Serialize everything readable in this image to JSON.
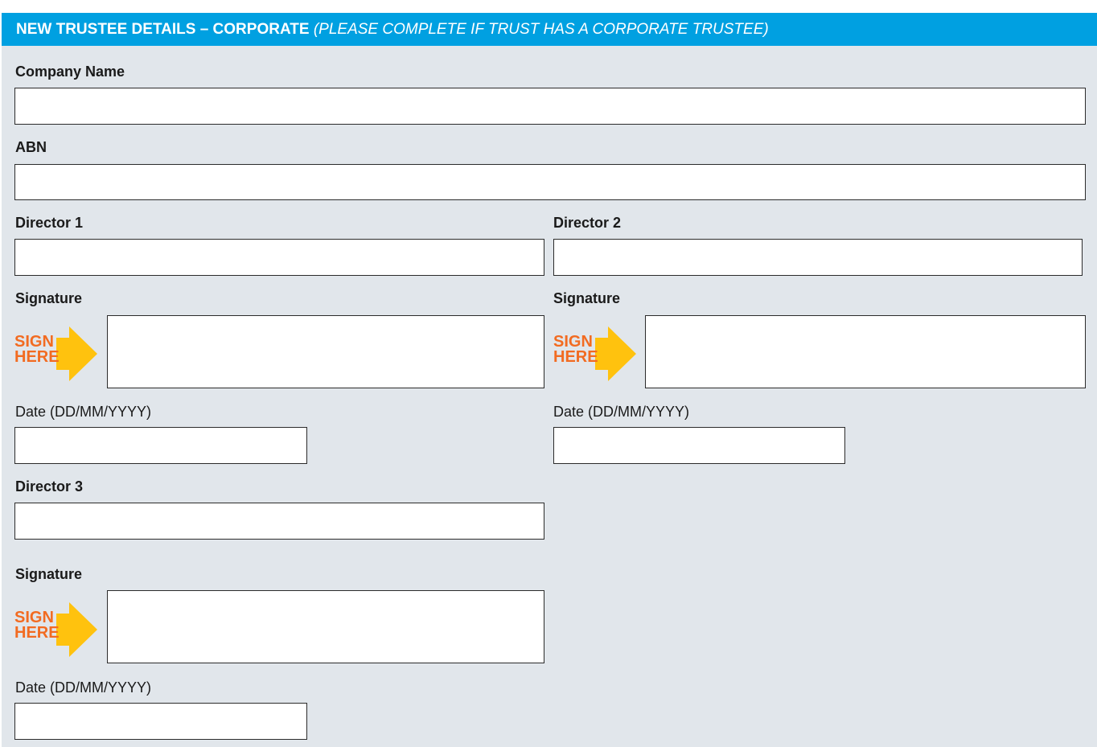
{
  "header": {
    "title": "NEW TRUSTEE DETAILS – CORPORATE",
    "note": "(PLEASE COMPLETE IF TRUST HAS A CORPORATE TRUSTEE)"
  },
  "form": {
    "company_name_label": "Company Name",
    "company_name_value": "",
    "abn_label": "ABN",
    "abn_value": "",
    "director1": {
      "label": "Director 1",
      "value": "",
      "signature_label": "Signature",
      "date_label": "Date (DD/MM/YYYY)",
      "date_value": ""
    },
    "director2": {
      "label": "Director 2",
      "value": "",
      "signature_label": "Signature",
      "date_label": "Date (DD/MM/YYYY)",
      "date_value": ""
    },
    "director3": {
      "label": "Director 3",
      "value": "",
      "signature_label": "Signature",
      "date_label": "Date (DD/MM/YYYY)",
      "date_value": ""
    }
  },
  "sign_here": {
    "line1": "SIGN",
    "line2": "HERE",
    "text_color": "#f26b21",
    "arrow_color": "#ffc20e",
    "icon": "sign-here-arrow-icon"
  },
  "colors": {
    "header_bg": "#00a0e1",
    "panel_bg": "#e1e6eb"
  }
}
